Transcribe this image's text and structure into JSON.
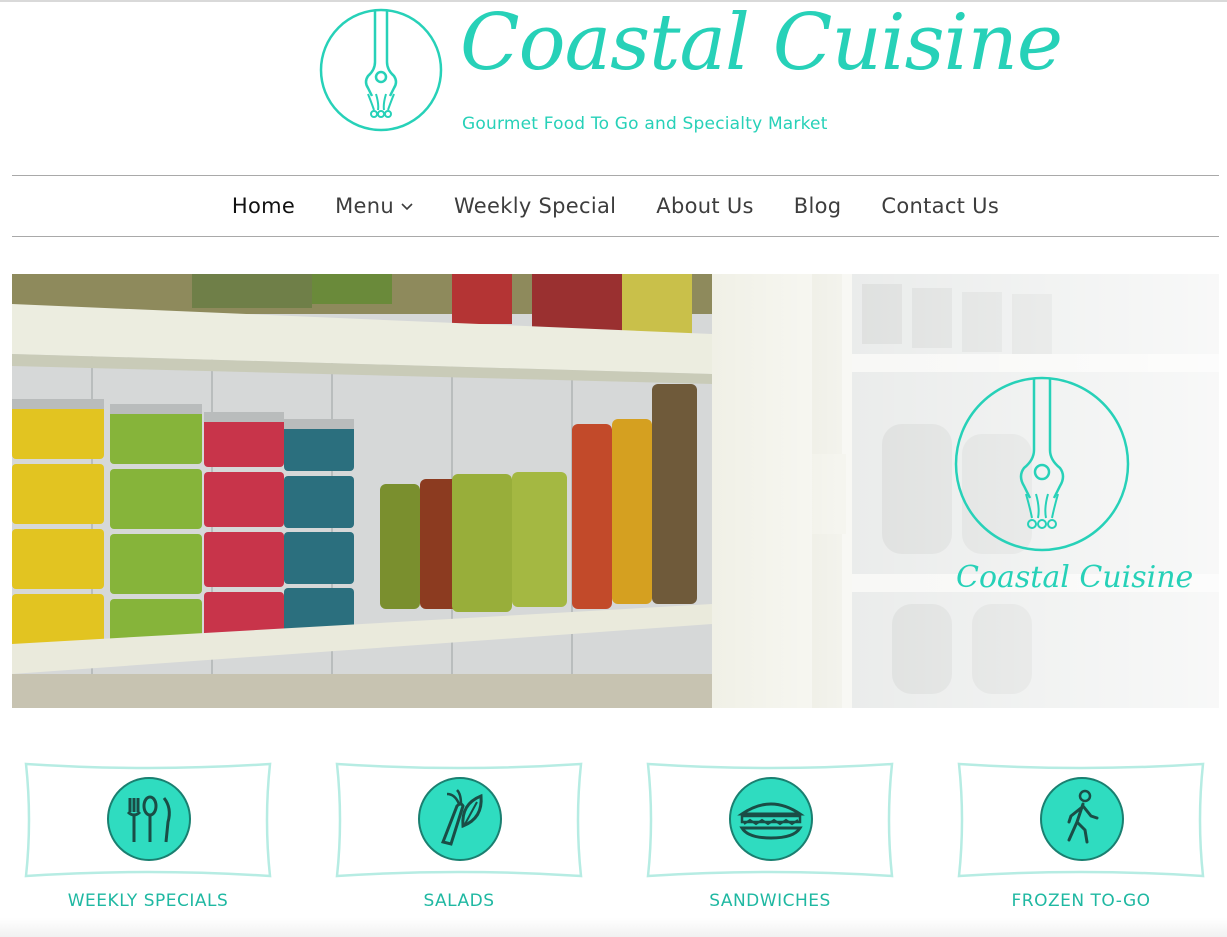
{
  "brand": {
    "name": "Coastal Cuisine",
    "tagline": "Gourmet Food To Go and Specialty Market",
    "hero_logo_text": "Coastal Cuisine",
    "accent_color": "#27d1b8"
  },
  "nav": {
    "items": [
      {
        "label": "Home",
        "active": true
      },
      {
        "label": "Menu",
        "has_dropdown": true
      },
      {
        "label": "Weekly Special"
      },
      {
        "label": "About Us"
      },
      {
        "label": "Blog"
      },
      {
        "label": "Contact Us"
      }
    ]
  },
  "hero": {
    "image_semantic": "specialty-market-shelf-photo"
  },
  "features": [
    {
      "label": "WEEKLY SPECIALS",
      "icon": "utensils-icon"
    },
    {
      "label": "SALADS",
      "icon": "vegetables-icon"
    },
    {
      "label": "SANDWICHES",
      "icon": "sandwich-icon"
    },
    {
      "label": "FROZEN TO-GO",
      "icon": "walking-person-icon"
    }
  ]
}
